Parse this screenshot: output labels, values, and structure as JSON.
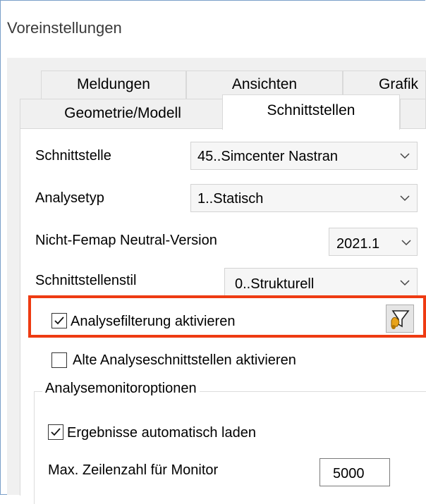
{
  "window": {
    "title": "Voreinstellungen"
  },
  "tabs": {
    "row1": [
      "Meldungen",
      "Ansichten",
      "Grafik"
    ],
    "row2": [
      "Geometrie/Modell",
      "Schnittstellen"
    ],
    "active": "Schnittstellen"
  },
  "settings": {
    "interface": {
      "label": "Schnittstelle",
      "value": "45..Simcenter Nastran"
    },
    "analysis_type": {
      "label": "Analysetyp",
      "value": "1..Statisch"
    },
    "neutral_version": {
      "label": "Nicht-Femap Neutral-Version",
      "value": "2021.1"
    },
    "interface_style": {
      "label": "Schnittstellenstil",
      "value": "0..Strukturell"
    },
    "analysis_filter": {
      "label": "Analysefilterung aktivieren",
      "checked": true
    },
    "old_interfaces": {
      "label": "Alte Analyseschnittstellen aktivieren",
      "checked": false
    }
  },
  "monitor": {
    "group_title": "Analysemonitoroptionen",
    "auto_load": {
      "label": "Ergebnisse automatisch laden",
      "checked": true
    },
    "max_lines": {
      "label": "Max. Zeilenzahl für Monitor",
      "value": "5000"
    }
  },
  "colors": {
    "highlight": "#ee3b12",
    "window_border": "#7a9fc9"
  },
  "icons": {
    "filter_button": "funnel-filter-icon",
    "dropdown": "chevron-down-icon",
    "check": "checkmark-icon"
  }
}
